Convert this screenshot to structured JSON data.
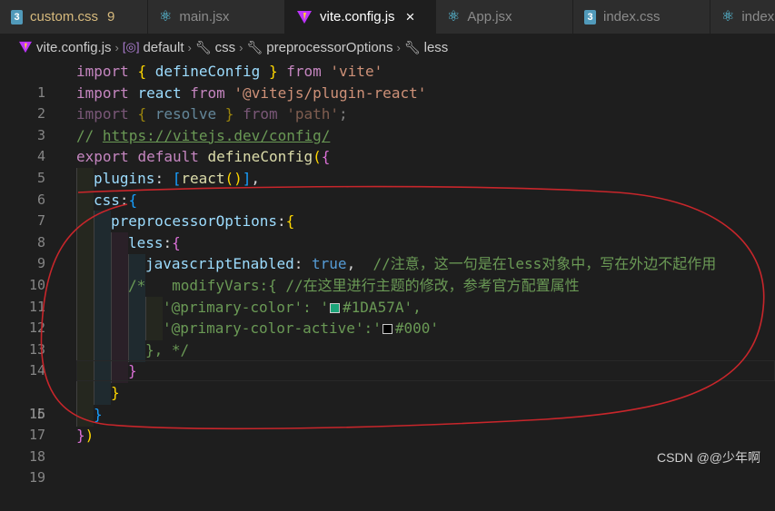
{
  "tabs": [
    {
      "label": "custom.css",
      "badge": "9",
      "icon": "css-icon",
      "modified": true,
      "active": false
    },
    {
      "label": "main.jsx",
      "icon": "react-icon",
      "active": false
    },
    {
      "label": "vite.config.js",
      "icon": "vite-icon",
      "active": true,
      "close": "×"
    },
    {
      "label": "App.jsx",
      "icon": "react-icon",
      "active": false
    },
    {
      "label": "index.css",
      "icon": "css-icon",
      "active": false
    },
    {
      "label": "index.",
      "icon": "react-icon",
      "active": false
    }
  ],
  "breadcrumb": {
    "file": "vite.config.js",
    "seg1": "default",
    "seg2": "css",
    "seg3": "preprocessorOptions",
    "seg4": "less"
  },
  "current_line": 15,
  "code": {
    "l1": {
      "import": "import",
      "open": "{",
      "name": "defineConfig",
      "close": "}",
      "from": "from",
      "mod": "'vite'"
    },
    "l2": {
      "import": "import",
      "name": "react",
      "from": "from",
      "mod": "'@vitejs/plugin-react'"
    },
    "l3": {
      "import": "import",
      "open": "{",
      "name": "resolve",
      "close": "}",
      "from": "from",
      "mod": "'path'",
      "semi": ";"
    },
    "l4": {
      "slashes": "// ",
      "url": "https://vitejs.dev/config/"
    },
    "l5": {
      "export": "export",
      "default": "default",
      "fn": "defineConfig",
      "paren": "(",
      "brace": "{"
    },
    "l6": {
      "key": "plugins",
      "colon": ": ",
      "open": "[",
      "fn": "react",
      "parens": "()",
      "close": "]",
      "comma": ","
    },
    "l7": {
      "key": "css",
      "colon": ":",
      "brace": "{"
    },
    "l8": {
      "key": "preprocessorOptions",
      "colon": ":",
      "brace": "{"
    },
    "l9": {
      "key": "less",
      "colon": ":",
      "brace": "{"
    },
    "l10": {
      "key": "javascriptEnabled",
      "colon": ": ",
      "value": "true",
      "comma": ",",
      "comment": "  //注意，这一句是在less对象中，写在外边不起作用"
    },
    "l11": {
      "text": "/*   modifyVars:{ //在这里进行主题的修改，参考官方配置属性"
    },
    "l12": {
      "before": "'@primary-color': '",
      "color_hex": "#1DA57A",
      "value": "#1DA57A",
      "after": "',"
    },
    "l13": {
      "before": "'@primary-color-active':'",
      "color_hex": "#000000",
      "value": "#000",
      "after": "'"
    },
    "l14": {
      "text": "}, */"
    },
    "l16": {
      "brace": "}"
    },
    "l17": {
      "brace": "}"
    },
    "l18": {
      "brace": "}",
      "paren": ")"
    }
  },
  "line_numbers": [
    "1",
    "2",
    "3",
    "4",
    "5",
    "6",
    "7",
    "8",
    "9",
    "10",
    "11",
    "12",
    "13",
    "14",
    "15",
    "16",
    "17",
    "18",
    "19"
  ],
  "watermark": "CSDN @@少年啊",
  "colors": {
    "background": "#1e1e1e",
    "keyword": "#c586c0",
    "function": "#dcdcaa",
    "variable": "#9cdcfe",
    "string": "#ce9178",
    "comment": "#6a9955",
    "annotation": "#c8262b"
  }
}
